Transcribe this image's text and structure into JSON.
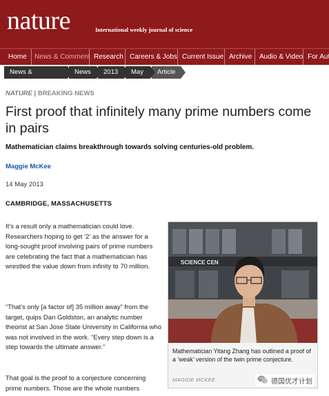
{
  "masthead": {
    "logo": "nature",
    "tagline": "International weekly journal of science"
  },
  "nav": {
    "items": [
      "Home",
      "News & Comment",
      "Research",
      "Careers & Jobs",
      "Current Issue",
      "Archive",
      "Audio & Video",
      "For Aut"
    ],
    "active_index": 1
  },
  "breadcrumb": [
    "News & Comment",
    "News",
    "2013",
    "May",
    "Article"
  ],
  "article": {
    "section_journal": "NATURE",
    "section_separator": "|",
    "section_type": "BREAKING NEWS",
    "title": "First proof that infinitely many prime numbers come in pairs",
    "standfirst": "Mathematician claims breakthrough towards solving centuries-old problem.",
    "author": "Maggie McKee",
    "date": "14 May 2013",
    "dateline": "CAMBRIDGE, MASSACHUSETTS",
    "paragraphs": [
      "It's a result only a mathematician could love. Researchers hoping to get ‘2’ as the answer for a long-sought proof involving pairs of prime numbers are celebrating the fact that a mathematician has wrestled the value down from infinity to 70 million.",
      "“That's only [a factor of] 35 million away” from the target, quips Dan Goldston, an analytic number theorist at San Jose State University in California who was not involved in the work. “Every step down is a step towards the ultimate answer.”",
      "That goal is the proof to a conjecture concerning prime numbers. Those are the whole numbers"
    ]
  },
  "figure": {
    "sign_text": "SCIENCE CEN",
    "caption": "Mathematician Yitang Zhang has outlined a proof of a ‘weak’ version of the twin prime conjecture.",
    "credit": "MAGGIE MCKEE"
  },
  "watermark": {
    "icon": "wechat-icon",
    "text": "德国优才计划"
  },
  "colors": {
    "brand": "#8f1a1c",
    "breadcrumb": "#333333",
    "author_link": "#1a56a8"
  }
}
